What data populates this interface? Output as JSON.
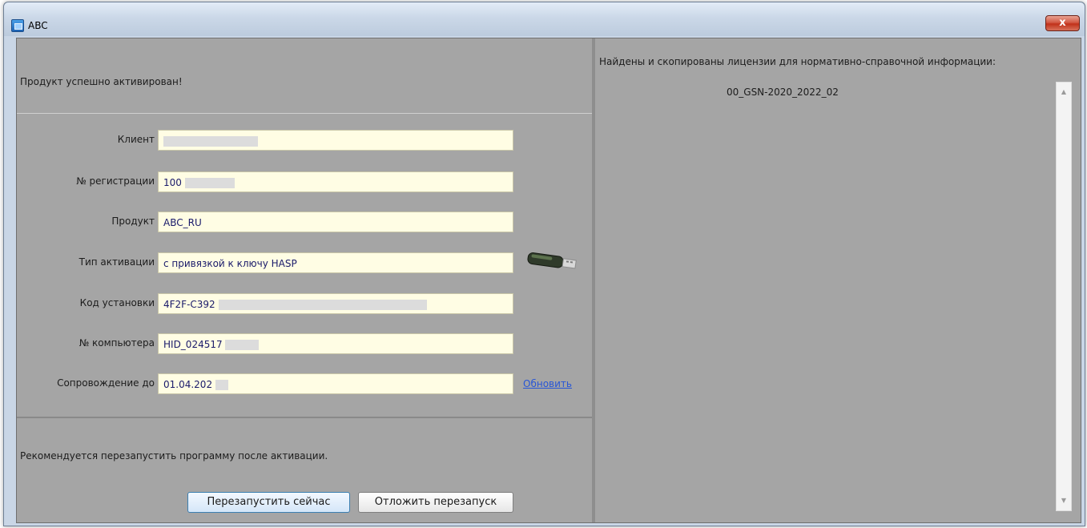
{
  "window": {
    "title": "ABC",
    "close_label": "x"
  },
  "left": {
    "status_message": "Продукт успешно активирован!",
    "fields": [
      {
        "label": "Клиент",
        "value": ""
      },
      {
        "label": "№ регистрации",
        "value": "100"
      },
      {
        "label": "Продукт",
        "value": "ABC_RU"
      },
      {
        "label": "Тип активации",
        "value": "с привязкой к ключу HASP"
      },
      {
        "label": "Код установки",
        "value": "4F2F-C392"
      },
      {
        "label": "№ компьютера",
        "value": "HID_024517"
      },
      {
        "label": "Сопровождение до",
        "value": "01.04.202"
      }
    ],
    "update_link": "Обновить",
    "restart_message": "Рекомендуется перезапустить программу после активации.",
    "restart_now_label": "Перезапустить сейчас",
    "postpone_label": "Отложить перезапуск"
  },
  "right": {
    "title": "Найдены и скопированы лицензии для нормативно-справочной информации:",
    "licenses": [
      "00_GSN-2020_2022_02"
    ],
    "scroll_up_glyph": "▲",
    "scroll_down_glyph": "▼"
  },
  "icons": {
    "app": "app-icon",
    "close": "close-icon",
    "hasp_key": "usb-key-icon"
  },
  "colors": {
    "panel_bg": "#a5a5a5",
    "field_bg": "#fffde4",
    "link": "#2856d6"
  }
}
